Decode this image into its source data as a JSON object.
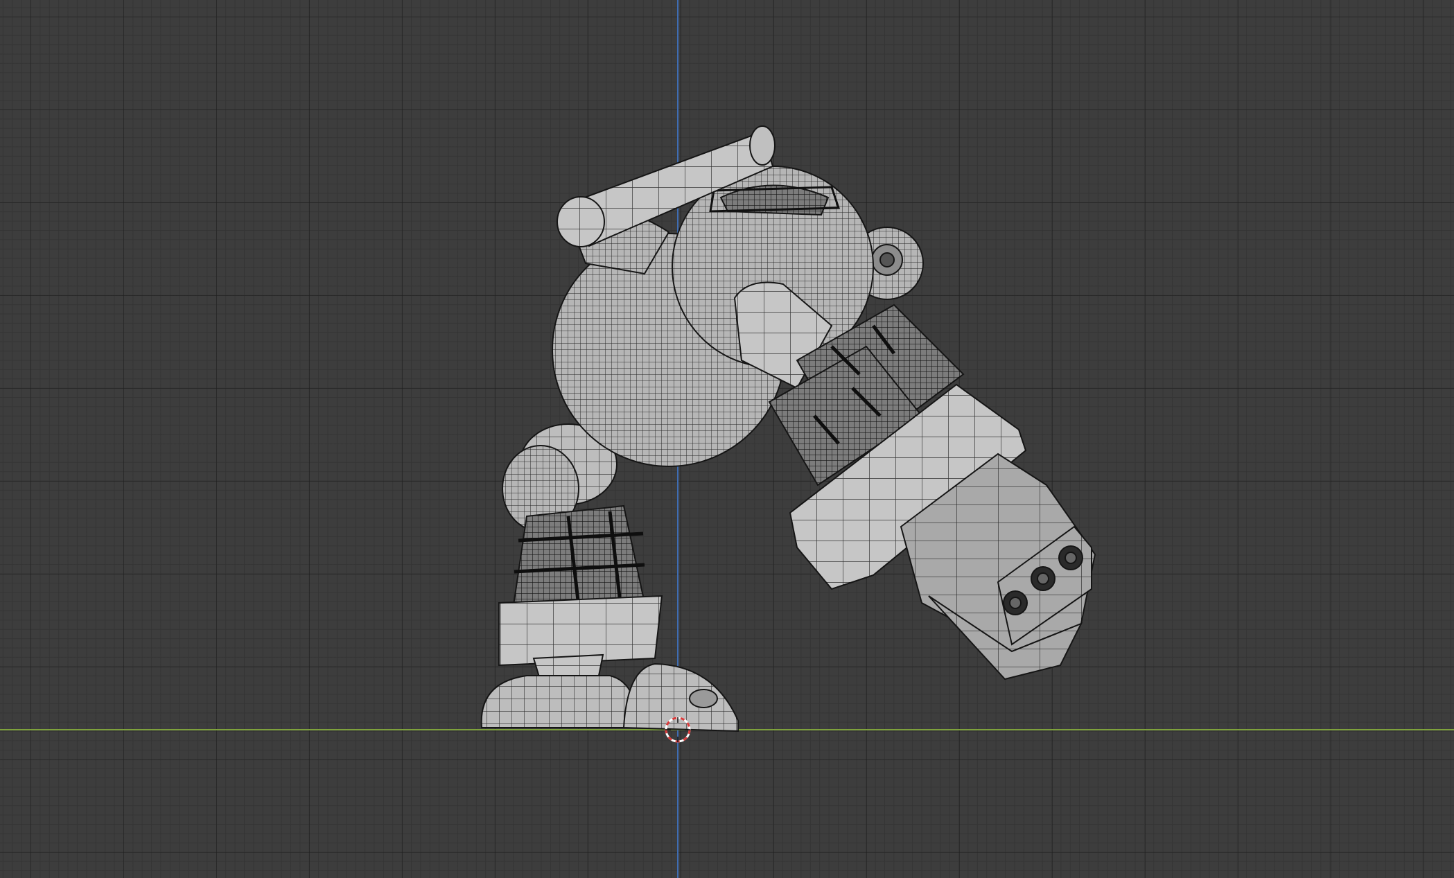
{
  "viewport": {
    "background_color": "#3d3d3d",
    "grid_minor_color": "#343434",
    "grid_major_color": "#1e1e1e",
    "axis_z_color": "#3f6db3",
    "axis_y_color": "#7ea23c"
  },
  "model": {
    "shading": "solid-wireframe",
    "surface_color": "#b8b8b8",
    "wire_color": "#1a1a1a"
  },
  "cursor_3d": {
    "colors": [
      "#d93a3a",
      "#ffffff"
    ]
  }
}
